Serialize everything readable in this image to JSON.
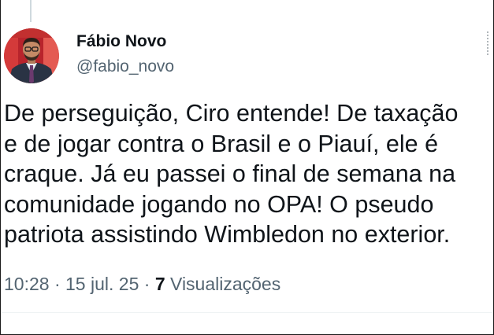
{
  "tweet": {
    "author": {
      "display_name": "Fábio Novo",
      "handle": "@fabio_novo",
      "avatar_icon": "profile-photo"
    },
    "text_lines": [
      "De perseguição, Ciro entende! De taxação",
      "e de jogar contra o Brasil e o Piauí, ele é",
      "craque. Já eu passei o final de semana na",
      "comunidade jogando no OPA! O pseudo",
      "patriota assistindo Wimbledon no exterior."
    ],
    "meta": {
      "time": "10:28",
      "separator": "·",
      "date": "15 jul. 25",
      "views_count": "7",
      "views_label": "Visualizações"
    }
  },
  "colors": {
    "text_primary": "#0f1419",
    "text_secondary": "#536471",
    "background": "#ffffff"
  }
}
